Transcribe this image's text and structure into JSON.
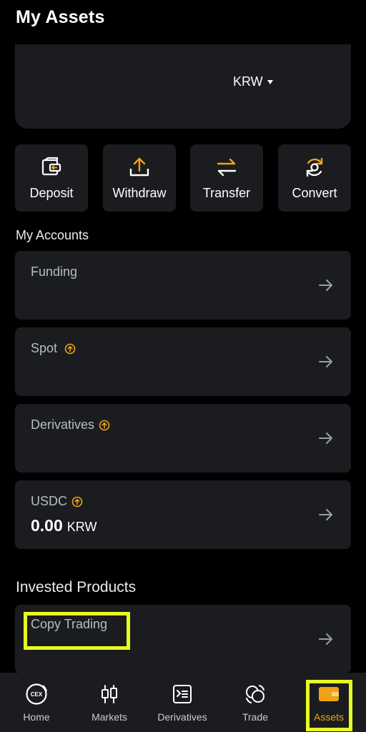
{
  "header": {
    "title": "My Assets"
  },
  "balance": {
    "currency": "KRW"
  },
  "actions": [
    {
      "label": "Deposit",
      "icon": "deposit-wallet-icon"
    },
    {
      "label": "Withdraw",
      "icon": "upload-arrow-icon"
    },
    {
      "label": "Transfer",
      "icon": "swap-arrows-icon"
    },
    {
      "label": "Convert",
      "icon": "convert-cycle-icon"
    }
  ],
  "accounts_section": {
    "title": "My Accounts",
    "items": [
      {
        "name": "Funding",
        "upgrade": false
      },
      {
        "name": "Spot",
        "upgrade": true
      },
      {
        "name": "Derivatives",
        "upgrade": true
      },
      {
        "name": "USDC",
        "upgrade": true,
        "value": "0.00",
        "unit": "KRW"
      }
    ]
  },
  "invested_section": {
    "title": "Invested Products",
    "items": [
      {
        "name": "Copy Trading"
      }
    ]
  },
  "bottom_nav": {
    "items": [
      {
        "label": "Home",
        "icon": "cex-logo-icon"
      },
      {
        "label": "Markets",
        "icon": "candlestick-icon"
      },
      {
        "label": "Derivatives",
        "icon": "derivatives-doc-icon"
      },
      {
        "label": "Trade",
        "icon": "trade-coins-icon"
      },
      {
        "label": "Assets",
        "icon": "wallet-icon",
        "active": true
      }
    ]
  },
  "colors": {
    "accent": "#f0a216",
    "highlight": "#e7ff1f",
    "card": "#1b1c1f",
    "background": "#000000"
  }
}
